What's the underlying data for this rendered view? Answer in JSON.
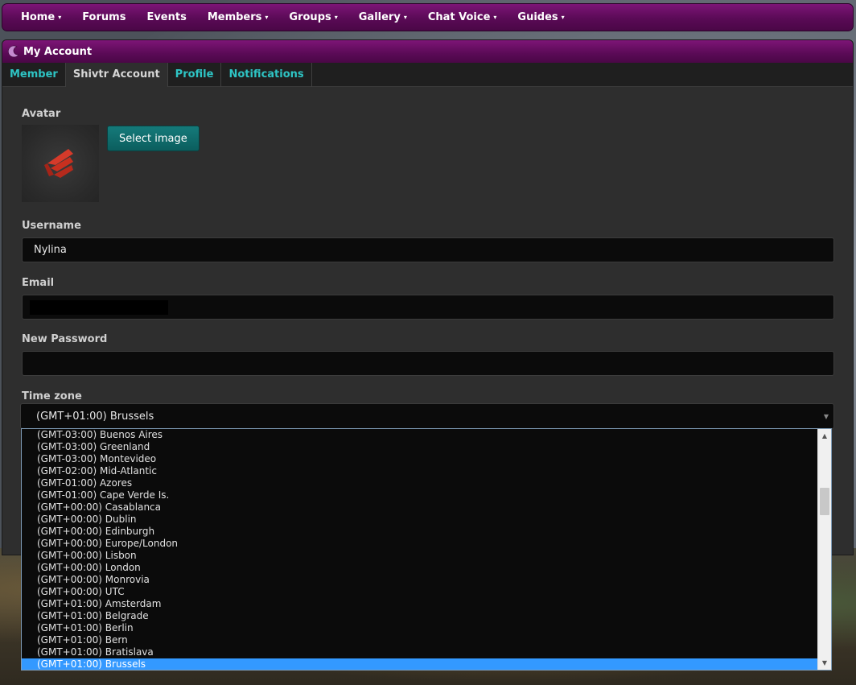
{
  "nav": {
    "items": [
      {
        "label": "Home",
        "caret": "▾"
      },
      {
        "label": "Forums",
        "caret": ""
      },
      {
        "label": "Events",
        "caret": ""
      },
      {
        "label": "Members",
        "caret": "▾"
      },
      {
        "label": "Groups",
        "caret": "▾"
      },
      {
        "label": "Gallery",
        "caret": "▾"
      },
      {
        "label": "Chat Voice",
        "caret": "▾"
      },
      {
        "label": "Guides",
        "caret": "▾"
      }
    ]
  },
  "panel": {
    "title": "My Account",
    "tabs": [
      {
        "label": "Member",
        "active": false
      },
      {
        "label": "Shivtr Account",
        "active": true
      },
      {
        "label": "Profile",
        "active": false
      },
      {
        "label": "Notifications",
        "active": false
      }
    ]
  },
  "form": {
    "avatar_label": "Avatar",
    "select_image_label": "Select image",
    "username_label": "Username",
    "username_value": "Nylina",
    "email_label": "Email",
    "password_label": "New Password",
    "timezone_label": "Time zone",
    "timezone_value": "(GMT+01:00) Brussels"
  },
  "timezone_options": [
    "(GMT-03:00) Buenos Aires",
    "(GMT-03:00) Greenland",
    "(GMT-03:00) Montevideo",
    "(GMT-02:00) Mid-Atlantic",
    "(GMT-01:00) Azores",
    "(GMT-01:00) Cape Verde Is.",
    "(GMT+00:00) Casablanca",
    "(GMT+00:00) Dublin",
    "(GMT+00:00) Edinburgh",
    "(GMT+00:00) Europe/London",
    "(GMT+00:00) Lisbon",
    "(GMT+00:00) London",
    "(GMT+00:00) Monrovia",
    "(GMT+00:00) UTC",
    "(GMT+01:00) Amsterdam",
    "(GMT+01:00) Belgrade",
    "(GMT+01:00) Berlin",
    "(GMT+01:00) Bern",
    "(GMT+01:00) Bratislava",
    "(GMT+01:00) Brussels"
  ],
  "selected_index": 19,
  "colors": {
    "brand_purple": "#5a0a56",
    "accent_teal": "#2ec4c4",
    "selection_blue": "#3399ff"
  },
  "icons": {
    "panel_logo": "crescent-logo-icon",
    "avatar": "shivtr-logo-icon"
  }
}
